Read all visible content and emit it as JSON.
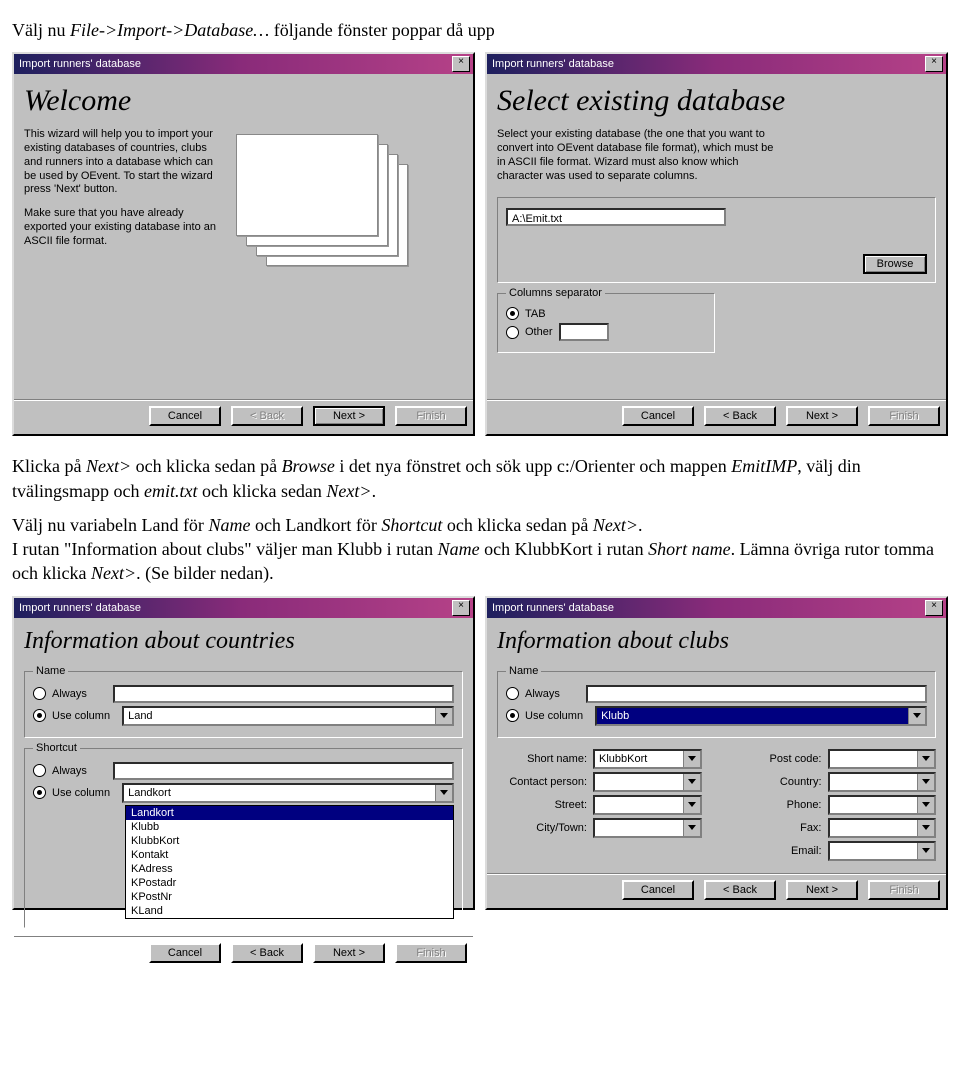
{
  "intro": {
    "p1_pre": "Välj nu ",
    "p1_it": "File->Import->Database…",
    "p1_post": " följande fönster poppar då upp"
  },
  "dlgA": {
    "title": "Import runners' database",
    "heading": "Welcome",
    "desc1": "This wizard will help you to import your existing databases of countries, clubs and runners into a database which can be used by OEvent. To start the wizard press 'Next' button.",
    "desc2": "Make sure that you have already exported your existing database into an ASCII file format.",
    "btn_cancel": "Cancel",
    "btn_back": "< Back",
    "btn_next": "Next >",
    "btn_finish": "Finish"
  },
  "dlgB": {
    "title": "Import runners' database",
    "heading": "Select existing database",
    "desc": "Select your existing database (the one that you want to convert into OEvent database file format), which must be in ASCII file format. Wizard must also know which character was used to separate columns.",
    "path": "A:\\Emit.txt",
    "browse": "Browse",
    "sep_legend": "Columns separator",
    "opt_tab": "TAB",
    "opt_other": "Other",
    "btn_cancel": "Cancel",
    "btn_back": "< Back",
    "btn_next": "Next >",
    "btn_finish": "Finish"
  },
  "mid": {
    "p2a": "Klicka på ",
    "p2b": "Next>",
    "p2c": " och klicka sedan på ",
    "p2d": "Browse",
    "p2e": " i det nya fönstret och sök upp c:/Orienter och mappen ",
    "p2f": "EmitIMP",
    "p2g": ", välj din tvälingsmapp och ",
    "p2h": "emit.txt",
    "p2i": " och klicka sedan ",
    "p2j": "Next>",
    "p2k": ".",
    "p3a": "Välj nu variabeln Land för ",
    "p3b": "Name",
    "p3c": " och Landkort för ",
    "p3d": "Shortcut",
    "p3e": " och klicka sedan på ",
    "p3f": "Next>",
    "p3g": ".",
    "p4a": "I rutan \"Information about clubs\" väljer man Klubb i rutan ",
    "p4b": "Name",
    "p4c": " och KlubbKort i rutan ",
    "p4d": "Short name",
    "p4e": ". Lämna övriga rutor tomma och klicka ",
    "p4f": "Next>",
    "p4g": ". (Se bilder nedan)."
  },
  "dlgC": {
    "title": "Import runners' database",
    "heading": "Information about countries",
    "group_name": "Name",
    "opt_always": "Always",
    "opt_usecol": "Use column",
    "name_val": "Land",
    "group_short": "Shortcut",
    "short_val": "Landkort",
    "dropdown": [
      "Landkort",
      "Klubb",
      "KlubbKort",
      "Kontakt",
      "KAdress",
      "KPostadr",
      "KPostNr",
      "KLand"
    ],
    "btn_cancel": "Cancel",
    "btn_back": "< Back",
    "btn_next": "Next >",
    "btn_finish": "Finish"
  },
  "dlgD": {
    "title": "Import runners' database",
    "heading": "Information about clubs",
    "group_name": "Name",
    "opt_always": "Always",
    "opt_usecol": "Use column",
    "name_val": "Klubb",
    "lbl_short": "Short name:",
    "val_short": "KlubbKort",
    "lbl_post": "Post code:",
    "lbl_contact": "Contact person:",
    "lbl_country": "Country:",
    "lbl_street": "Street:",
    "lbl_phone": "Phone:",
    "lbl_city": "City/Town:",
    "lbl_fax": "Fax:",
    "lbl_email": "Email:",
    "btn_cancel": "Cancel",
    "btn_back": "< Back",
    "btn_next": "Next >",
    "btn_finish": "Finish"
  }
}
